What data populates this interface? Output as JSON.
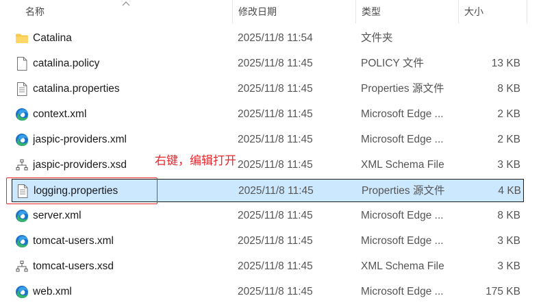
{
  "columns": {
    "name": "名称",
    "date": "修改日期",
    "type": "类型",
    "size": "大小"
  },
  "files": [
    {
      "name": "Catalina",
      "date": "2025/11/8 11:54",
      "type": "文件夹",
      "size": "",
      "icon": "folder-icon"
    },
    {
      "name": "catalina.policy",
      "date": "2025/11/8 11:45",
      "type": "POLICY 文件",
      "size": "13 KB",
      "icon": "file-icon"
    },
    {
      "name": "catalina.properties",
      "date": "2025/11/8 11:45",
      "type": "Properties 源文件",
      "size": "8 KB",
      "icon": "text-file-icon"
    },
    {
      "name": "context.xml",
      "date": "2025/11/8 11:45",
      "type": "Microsoft Edge ...",
      "size": "2 KB",
      "icon": "edge-icon"
    },
    {
      "name": "jaspic-providers.xml",
      "date": "2025/11/8 11:45",
      "type": "Microsoft Edge ...",
      "size": "2 KB",
      "icon": "edge-icon"
    },
    {
      "name": "jaspic-providers.xsd",
      "date": "2025/11/8 11:45",
      "type": "XML Schema File",
      "size": "3 KB",
      "icon": "xsd-icon"
    },
    {
      "name": "logging.properties",
      "date": "2025/11/8 11:45",
      "type": "Properties 源文件",
      "size": "4 KB",
      "icon": "text-file-icon",
      "selected": true
    },
    {
      "name": "server.xml",
      "date": "2025/11/8 11:45",
      "type": "Microsoft Edge ...",
      "size": "8 KB",
      "icon": "edge-icon"
    },
    {
      "name": "tomcat-users.xml",
      "date": "2025/11/8 11:45",
      "type": "Microsoft Edge ...",
      "size": "3 KB",
      "icon": "edge-icon"
    },
    {
      "name": "tomcat-users.xsd",
      "date": "2025/11/8 11:45",
      "type": "XML Schema File",
      "size": "3 KB",
      "icon": "xsd-icon"
    },
    {
      "name": "web.xml",
      "date": "2025/11/8 11:45",
      "type": "Microsoft Edge ...",
      "size": "175 KB",
      "icon": "edge-icon"
    }
  ],
  "annotation": {
    "text": "右键，编辑打开",
    "color": "#e8262b"
  },
  "colors": {
    "selection_bg": "#cce8ff",
    "folder": "#f7c948",
    "edge_blue": "#1a73c9",
    "edge_green": "#35b36b"
  }
}
